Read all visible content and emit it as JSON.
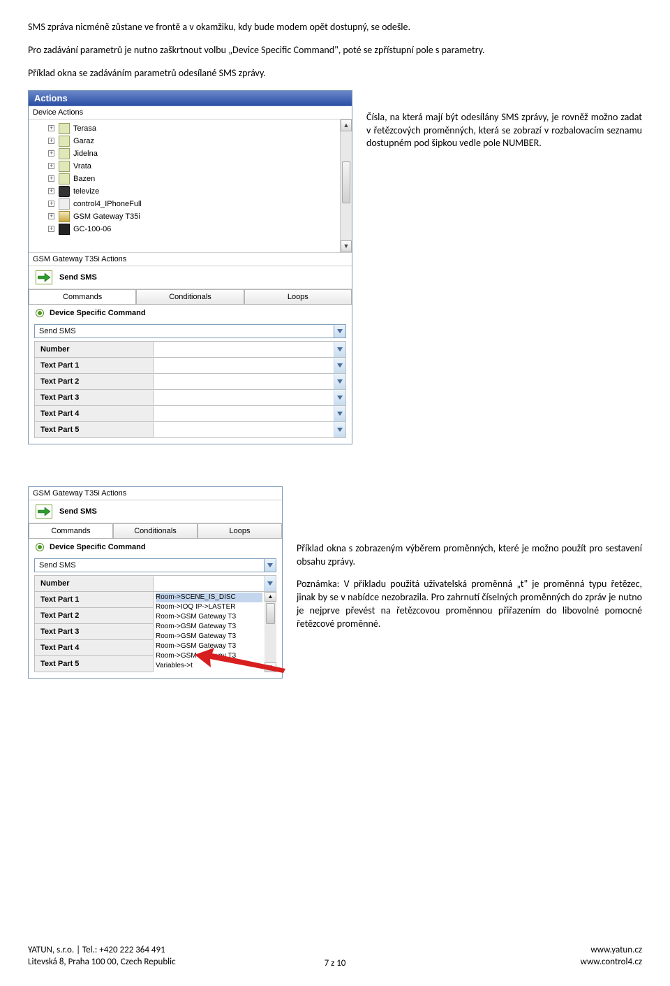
{
  "intro": {
    "p1": "SMS zpráva nicméně zůstane ve frontě a v okamžiku, kdy bude modem opět dostupný, se odešle.",
    "p2": "Pro zadávání parametrů je nutno zaškrtnout volbu „Device Specific Command\", poté se zpřístupní pole s parametry.",
    "p3": "Příklad okna se zadáváním parametrů odesílané SMS zprávy."
  },
  "panel1": {
    "header": "Actions",
    "section": "Device Actions",
    "tree": [
      {
        "label": "Terasa",
        "iconClass": "icon-box"
      },
      {
        "label": "Garaz",
        "iconClass": "icon-box"
      },
      {
        "label": "Jidelna",
        "iconClass": "icon-box"
      },
      {
        "label": "Vrata",
        "iconClass": "icon-box"
      },
      {
        "label": "Bazen",
        "iconClass": "icon-box"
      },
      {
        "label": "televize",
        "iconClass": "icon-tv"
      },
      {
        "label": "control4_IPhoneFull",
        "iconClass": "icon-c4"
      },
      {
        "label": "GSM Gateway T35i",
        "iconClass": "icon-gsm"
      },
      {
        "label": "GC-100-06",
        "iconClass": "icon-gc"
      }
    ],
    "actionsLabel": "GSM Gateway T35i Actions",
    "actionName": "Send SMS",
    "tabs": {
      "commands": "Commands",
      "conditionals": "Conditionals",
      "loops": "Loops"
    },
    "radioLabel": "Device Specific Command",
    "comboValue": "Send SMS",
    "fields": [
      "Number",
      "Text Part 1",
      "Text Part 2",
      "Text Part 3",
      "Text Part 4",
      "Text Part 5"
    ]
  },
  "side1": "Čísla, na která mají být odesílány SMS zprávy, je rovněž možno zadat v řetězcových proměnných, která se zobrazí v rozbalovacím seznamu dostupném pod šipkou vedle pole NUMBER.",
  "panel2": {
    "actionsLabel": "GSM Gateway T35i Actions",
    "actionName": "Send SMS",
    "tabs": {
      "commands": "Commands",
      "conditionals": "Conditionals",
      "loops": "Loops"
    },
    "radioLabel": "Device Specific Command",
    "comboValue": "Send SMS",
    "fields": [
      "Number",
      "Text Part 1",
      "Text Part 2",
      "Text Part 3",
      "Text Part 4",
      "Text Part 5"
    ],
    "listItems": [
      "Room->SCENE_IS_DISC",
      "Room->IOQ IP->LASTER",
      "Room->GSM Gateway T3",
      "Room->GSM Gateway T3",
      "Room->GSM Gateway T3",
      "Room->GSM Gateway T3",
      "Room->GSM Gateway T3",
      "Variables->t"
    ]
  },
  "side2": {
    "p1": "Příklad okna s zobrazeným výběrem proměnných, které je možno použít pro sestavení obsahu zprávy.",
    "p2": "Poznámka: V příkladu použitá uživatelská proměnná „t\" je proměnná typu řetězec, jinak by se v nabídce nezobrazila. Pro zahrnutí číselných proměnných do zpráv je nutno je nejprve převést na řetězcovou proměnnou přiřazením do libovolné pomocné řetězcové proměnné."
  },
  "footer": {
    "leftLine1": "YATUN, s.r.o. | Tel.: +420 222 364 491",
    "leftLine2": "Litevská 8, Praha 100 00, Czech Republic",
    "pageNum": "7 z 10",
    "rightLine1": "www.yatun.cz",
    "rightLine2": "www.control4.cz"
  }
}
